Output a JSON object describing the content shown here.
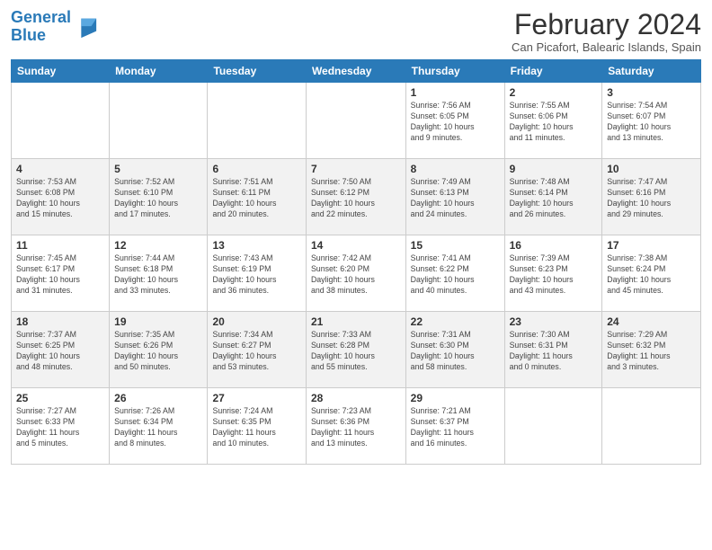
{
  "header": {
    "logo_general": "General",
    "logo_blue": "Blue",
    "month_title": "February 2024",
    "subtitle": "Can Picafort, Balearic Islands, Spain"
  },
  "days_of_week": [
    "Sunday",
    "Monday",
    "Tuesday",
    "Wednesday",
    "Thursday",
    "Friday",
    "Saturday"
  ],
  "weeks": [
    [
      {
        "day": "",
        "info": ""
      },
      {
        "day": "",
        "info": ""
      },
      {
        "day": "",
        "info": ""
      },
      {
        "day": "",
        "info": ""
      },
      {
        "day": "1",
        "info": "Sunrise: 7:56 AM\nSunset: 6:05 PM\nDaylight: 10 hours\nand 9 minutes."
      },
      {
        "day": "2",
        "info": "Sunrise: 7:55 AM\nSunset: 6:06 PM\nDaylight: 10 hours\nand 11 minutes."
      },
      {
        "day": "3",
        "info": "Sunrise: 7:54 AM\nSunset: 6:07 PM\nDaylight: 10 hours\nand 13 minutes."
      }
    ],
    [
      {
        "day": "4",
        "info": "Sunrise: 7:53 AM\nSunset: 6:08 PM\nDaylight: 10 hours\nand 15 minutes."
      },
      {
        "day": "5",
        "info": "Sunrise: 7:52 AM\nSunset: 6:10 PM\nDaylight: 10 hours\nand 17 minutes."
      },
      {
        "day": "6",
        "info": "Sunrise: 7:51 AM\nSunset: 6:11 PM\nDaylight: 10 hours\nand 20 minutes."
      },
      {
        "day": "7",
        "info": "Sunrise: 7:50 AM\nSunset: 6:12 PM\nDaylight: 10 hours\nand 22 minutes."
      },
      {
        "day": "8",
        "info": "Sunrise: 7:49 AM\nSunset: 6:13 PM\nDaylight: 10 hours\nand 24 minutes."
      },
      {
        "day": "9",
        "info": "Sunrise: 7:48 AM\nSunset: 6:14 PM\nDaylight: 10 hours\nand 26 minutes."
      },
      {
        "day": "10",
        "info": "Sunrise: 7:47 AM\nSunset: 6:16 PM\nDaylight: 10 hours\nand 29 minutes."
      }
    ],
    [
      {
        "day": "11",
        "info": "Sunrise: 7:45 AM\nSunset: 6:17 PM\nDaylight: 10 hours\nand 31 minutes."
      },
      {
        "day": "12",
        "info": "Sunrise: 7:44 AM\nSunset: 6:18 PM\nDaylight: 10 hours\nand 33 minutes."
      },
      {
        "day": "13",
        "info": "Sunrise: 7:43 AM\nSunset: 6:19 PM\nDaylight: 10 hours\nand 36 minutes."
      },
      {
        "day": "14",
        "info": "Sunrise: 7:42 AM\nSunset: 6:20 PM\nDaylight: 10 hours\nand 38 minutes."
      },
      {
        "day": "15",
        "info": "Sunrise: 7:41 AM\nSunset: 6:22 PM\nDaylight: 10 hours\nand 40 minutes."
      },
      {
        "day": "16",
        "info": "Sunrise: 7:39 AM\nSunset: 6:23 PM\nDaylight: 10 hours\nand 43 minutes."
      },
      {
        "day": "17",
        "info": "Sunrise: 7:38 AM\nSunset: 6:24 PM\nDaylight: 10 hours\nand 45 minutes."
      }
    ],
    [
      {
        "day": "18",
        "info": "Sunrise: 7:37 AM\nSunset: 6:25 PM\nDaylight: 10 hours\nand 48 minutes."
      },
      {
        "day": "19",
        "info": "Sunrise: 7:35 AM\nSunset: 6:26 PM\nDaylight: 10 hours\nand 50 minutes."
      },
      {
        "day": "20",
        "info": "Sunrise: 7:34 AM\nSunset: 6:27 PM\nDaylight: 10 hours\nand 53 minutes."
      },
      {
        "day": "21",
        "info": "Sunrise: 7:33 AM\nSunset: 6:28 PM\nDaylight: 10 hours\nand 55 minutes."
      },
      {
        "day": "22",
        "info": "Sunrise: 7:31 AM\nSunset: 6:30 PM\nDaylight: 10 hours\nand 58 minutes."
      },
      {
        "day": "23",
        "info": "Sunrise: 7:30 AM\nSunset: 6:31 PM\nDaylight: 11 hours\nand 0 minutes."
      },
      {
        "day": "24",
        "info": "Sunrise: 7:29 AM\nSunset: 6:32 PM\nDaylight: 11 hours\nand 3 minutes."
      }
    ],
    [
      {
        "day": "25",
        "info": "Sunrise: 7:27 AM\nSunset: 6:33 PM\nDaylight: 11 hours\nand 5 minutes."
      },
      {
        "day": "26",
        "info": "Sunrise: 7:26 AM\nSunset: 6:34 PM\nDaylight: 11 hours\nand 8 minutes."
      },
      {
        "day": "27",
        "info": "Sunrise: 7:24 AM\nSunset: 6:35 PM\nDaylight: 11 hours\nand 10 minutes."
      },
      {
        "day": "28",
        "info": "Sunrise: 7:23 AM\nSunset: 6:36 PM\nDaylight: 11 hours\nand 13 minutes."
      },
      {
        "day": "29",
        "info": "Sunrise: 7:21 AM\nSunset: 6:37 PM\nDaylight: 11 hours\nand 16 minutes."
      },
      {
        "day": "",
        "info": ""
      },
      {
        "day": "",
        "info": ""
      }
    ]
  ]
}
